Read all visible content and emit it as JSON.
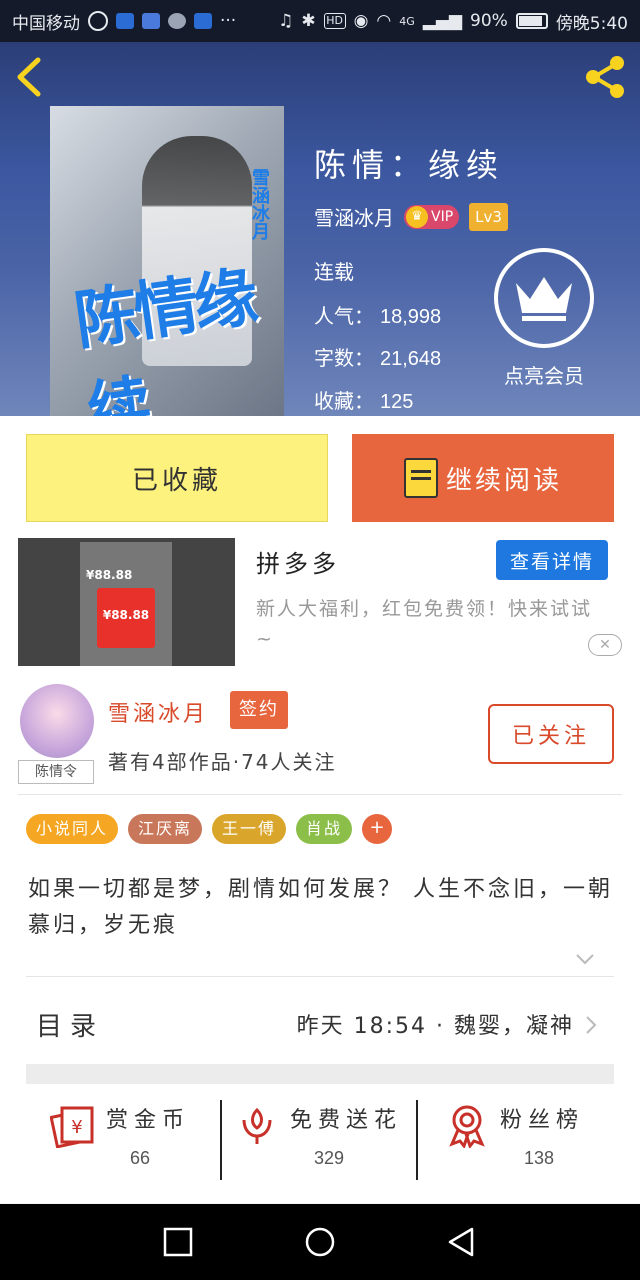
{
  "status_bar": {
    "carrier": "中国移动",
    "battery_percent": "90%",
    "battery_level": 0.9,
    "time": "傍晚5:40",
    "network": "4G"
  },
  "book": {
    "title": "陈情：缘续",
    "author": "雪涵冰月",
    "vip_label": "VIP",
    "level": "Lv3",
    "status": "连载",
    "popularity_label": "人气：",
    "popularity": "18,998",
    "words_label": "字数：",
    "words": "21,648",
    "favorites_label": "收藏：",
    "favorites": "125",
    "member_label": "点亮会员",
    "cover_title": "陈情缘续",
    "cover_author": "雪涵冰月"
  },
  "actions": {
    "collected_label": "已收藏",
    "continue_label": "继续阅读"
  },
  "ad": {
    "title": "拼多多",
    "detail_button": "查看详情",
    "description": "新人大福利，红包免费领！快来试试~",
    "image_amount": "¥88.88",
    "close_icon": "close-icon"
  },
  "author_section": {
    "name": "雪涵冰月",
    "signed_label": "签约",
    "works_info": "著有4部作品·74人关注",
    "follow_label": "已关注",
    "avatar_tag": "陈情令"
  },
  "tags": [
    {
      "label": "小说同人",
      "color": "#f5a623"
    },
    {
      "label": "江厌离",
      "color": "#c9775a"
    },
    {
      "label": "王一傅",
      "color": "#d9a52a"
    },
    {
      "label": "肖战",
      "color": "#8cbf4a"
    }
  ],
  "tag_add": "+",
  "description": "如果一切都是梦，剧情如何发展？ 人生不念旧，一朝慕归，岁无痕",
  "catalog": {
    "label": "目录",
    "latest": "昨天 18:54 · 魏婴，凝神"
  },
  "stats": [
    {
      "label": "赏金币",
      "value": "66",
      "icon": "gold-coin-icon"
    },
    {
      "label": "免费送花",
      "value": "329",
      "icon": "flower-icon"
    },
    {
      "label": "粉丝榜",
      "value": "138",
      "icon": "ribbon-icon"
    }
  ],
  "colors": {
    "accent_orange": "#e8663e",
    "accent_yellow": "#fdf27d",
    "accent_blue": "#1e78e0",
    "header_blue": "#3c58a0"
  }
}
